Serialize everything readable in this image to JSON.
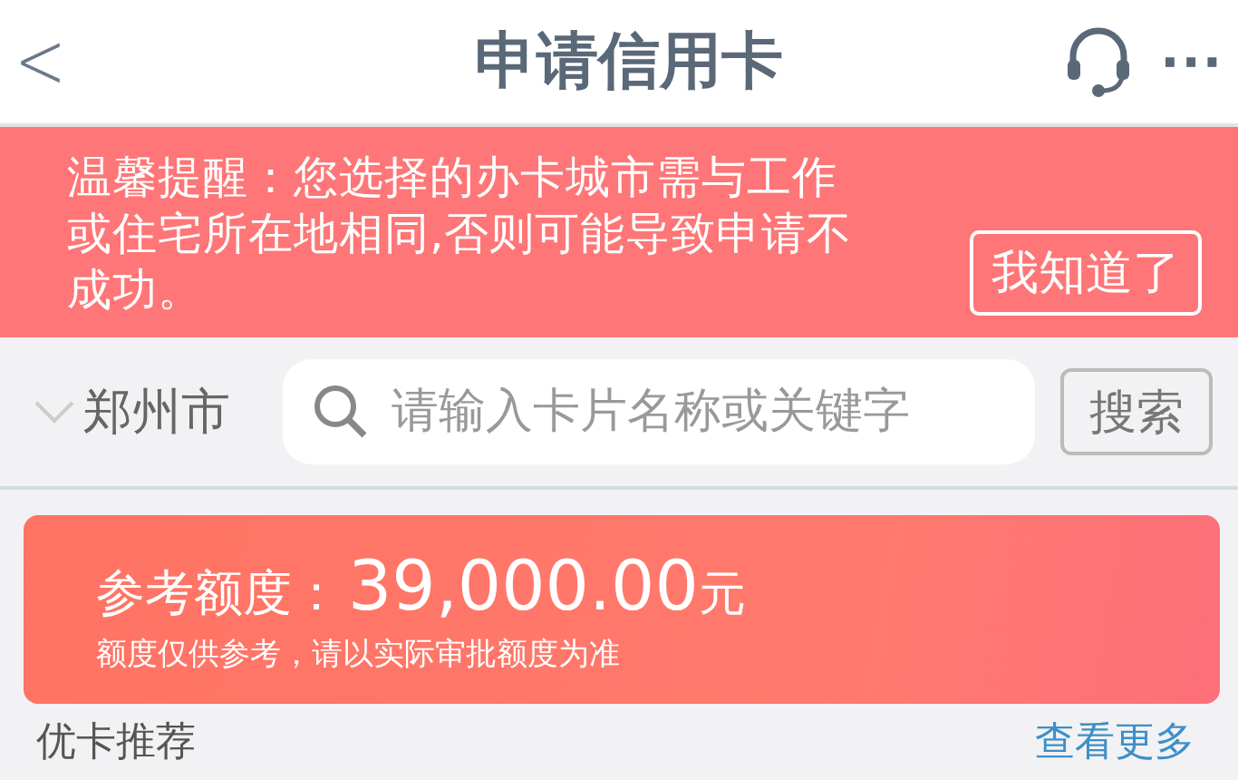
{
  "header": {
    "back": "<",
    "title": "申请信用卡",
    "more": "···"
  },
  "notice": {
    "text": "温馨提醒：您选择的办卡城市需与工作或住宅所在地相同,否则可能导致申请不成功。",
    "button": "我知道了"
  },
  "search": {
    "city": "郑州市",
    "placeholder": "请输入卡片名称或关键字",
    "button": "搜索"
  },
  "credit": {
    "label": "参考额度：",
    "amount": "39,000.00",
    "unit": "元",
    "note": "额度仅供参考，请以实际审批额度为准"
  },
  "section": {
    "title": "优卡推荐",
    "more": "查看更多"
  }
}
